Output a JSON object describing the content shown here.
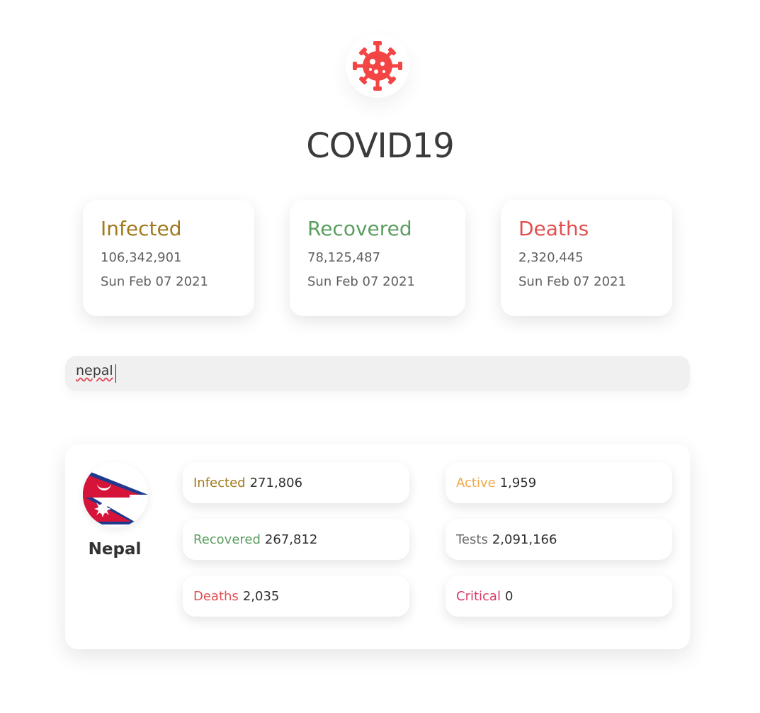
{
  "header": {
    "icon": "virus-icon",
    "title": "COVID19"
  },
  "colors": {
    "infected": "#a07a1c",
    "recovered": "#5a9e5f",
    "deaths": "#e34f4f",
    "active": "#f0a84b",
    "tests": "#6b6b6b",
    "critical": "#d83a64",
    "virus": "#f44545"
  },
  "global": {
    "infected": {
      "label": "Infected",
      "value": "106,342,901",
      "date": "Sun Feb 07 2021"
    },
    "recovered": {
      "label": "Recovered",
      "value": "78,125,487",
      "date": "Sun Feb 07 2021"
    },
    "deaths": {
      "label": "Deaths",
      "value": "2,320,445",
      "date": "Sun Feb 07 2021"
    }
  },
  "search": {
    "value": "nepal"
  },
  "country": {
    "name": "Nepal",
    "flag_icon": "nepal-flag-icon",
    "stats": {
      "infected": {
        "label": "Infected",
        "value": "271,806"
      },
      "recovered": {
        "label": "Recovered",
        "value": "267,812"
      },
      "deaths": {
        "label": "Deaths",
        "value": "2,035"
      },
      "active": {
        "label": "Active",
        "value": "1,959"
      },
      "tests": {
        "label": "Tests",
        "value": "2,091,166"
      },
      "critical": {
        "label": "Critical",
        "value": "0"
      }
    }
  }
}
